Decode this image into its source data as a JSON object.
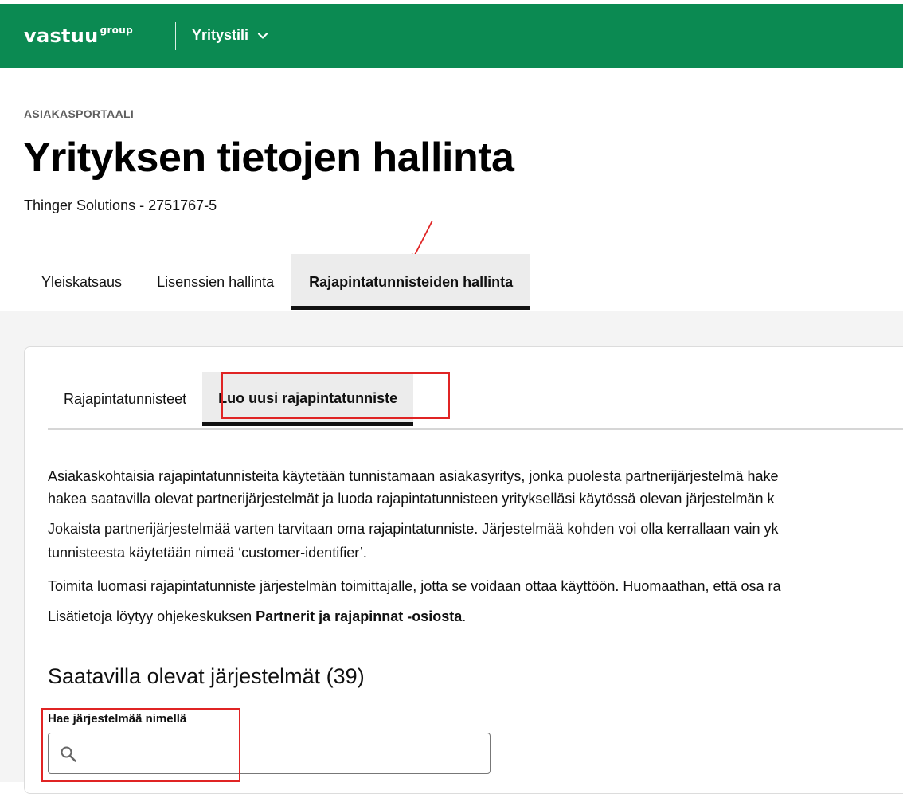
{
  "header": {
    "logo_text": "vastuu",
    "logo_sup": "group",
    "company_menu": "Yritystili",
    "color": "#0b8a52"
  },
  "page": {
    "eyebrow": "ASIAKASPORTAALI",
    "title": "Yrityksen tietojen hallinta",
    "company": "Thinger Solutions - 2751767-5"
  },
  "main_tabs": [
    {
      "label": "Yleiskatsaus"
    },
    {
      "label": "Lisenssien hallinta"
    },
    {
      "label": "Rajapintatunnisteiden hallinta",
      "active": true
    }
  ],
  "sub_tabs": [
    {
      "label": "Rajapintatunnisteet"
    },
    {
      "label": "Luo uusi rajapintatunniste",
      "active": true
    }
  ],
  "content": {
    "p1_line1": "Asiakaskohtaisia rajapintatunnisteita käytetään tunnistamaan asiakasyritys, jonka puolesta partnerijärjestelmä hake",
    "p1_line2": "hakea saatavilla olevat partnerijärjestelmät ja luoda rajapintatunnisteen yritykselläsi käytössä olevan järjestelmän k",
    "p2_line1": "Jokaista partnerijärjestelmää varten tarvitaan oma rajapintatunniste. Järjestelmää kohden voi olla kerrallaan vain yk",
    "p2_line2": "tunnisteesta käytetään nimeä ‘customer-identifier’.",
    "p3": "Toimita luomasi rajapintatunniste järjestelmän toimittajalle, jotta se voidaan ottaa käyttöön. Huomaathan, että osa ra",
    "p4_prefix": "Lisätietoja löytyy ohjekeskuksen ",
    "p4_link": "Partnerit ja rajapinnat -osiosta",
    "p4_suffix": "."
  },
  "systems": {
    "title": "Saatavilla olevat järjestelmät (39)",
    "search_label": "Hae järjestelmää nimellä",
    "search_value": ""
  },
  "annotation_color": "#e02424"
}
